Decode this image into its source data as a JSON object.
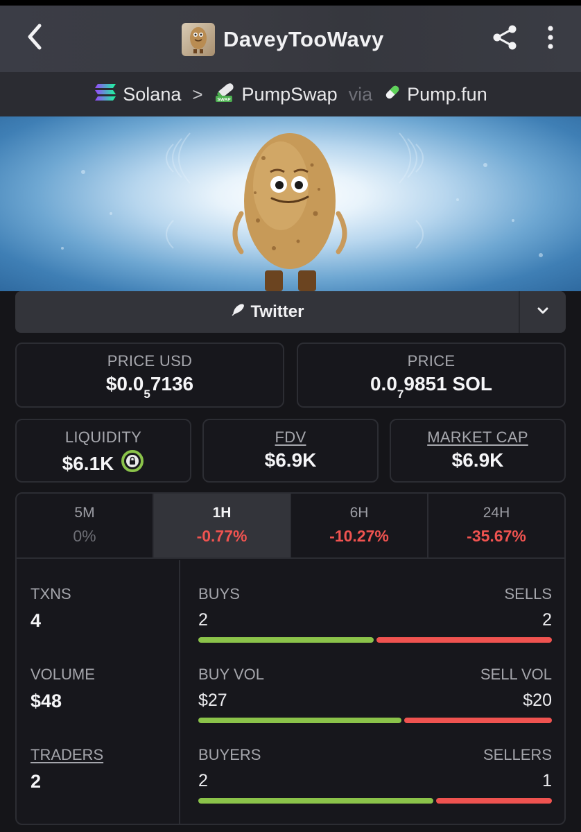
{
  "header": {
    "token_name": "DaveyTooWavy",
    "back_icon": "chevron-left-icon",
    "share_icon": "share-icon",
    "more_icon": "more-vertical-icon"
  },
  "chain": {
    "network": "Solana",
    "dex": "PumpSwap",
    "via": "via",
    "launchpad": "Pump.fun"
  },
  "links": {
    "twitter_label": "Twitter"
  },
  "prices": {
    "price_usd_label": "PRICE USD",
    "price_usd_prefix": "$0.0",
    "price_usd_sub": "5",
    "price_usd_suffix": "7136",
    "price_label": "PRICE",
    "price_prefix": "0.0",
    "price_sub": "7",
    "price_suffix": "9851 SOL"
  },
  "stats": {
    "liquidity_label": "LIQUIDITY",
    "liquidity_value": "$6.1K",
    "fdv_label": "FDV",
    "fdv_value": "$6.9K",
    "mcap_label": "MARKET CAP",
    "mcap_value": "$6.9K"
  },
  "timeframes": [
    {
      "label": "5M",
      "value": "0%",
      "tone": "neutral"
    },
    {
      "label": "1H",
      "value": "-0.77%",
      "tone": "neg"
    },
    {
      "label": "6H",
      "value": "-10.27%",
      "tone": "neg"
    },
    {
      "label": "24H",
      "value": "-35.67%",
      "tone": "neg"
    }
  ],
  "active_timeframe": "1H",
  "txns": {
    "txns_label": "TXNS",
    "txns_value": "4",
    "volume_label": "VOLUME",
    "volume_value": "$48",
    "traders_label": "TRADERS",
    "traders_value": "2",
    "buys_label": "BUYS",
    "sells_label": "SELLS",
    "buys_value": "2",
    "sells_value": "2",
    "buys_fraction": 0.5,
    "buyvol_label": "BUY VOL",
    "sellvol_label": "SELL VOL",
    "buyvol_value": "$27",
    "sellvol_value": "$20",
    "buyvol_fraction": 0.58,
    "buyers_label": "BUYERS",
    "sellers_label": "SELLERS",
    "buyers_value": "2",
    "sellers_value": "1",
    "buyers_fraction": 0.67
  },
  "colors": {
    "positive": "#8bc34a",
    "negative": "#ef5350",
    "liquidity_lock": "#8bc34a"
  }
}
